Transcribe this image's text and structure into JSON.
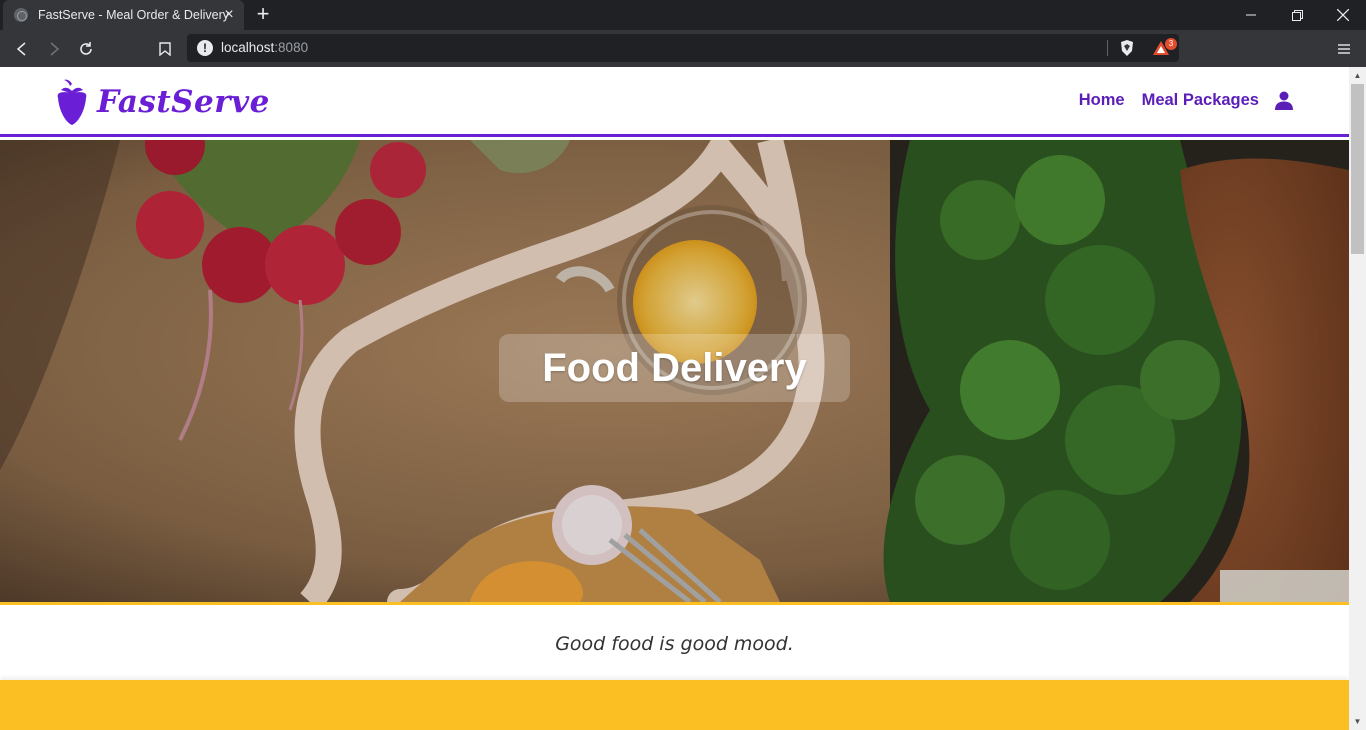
{
  "browser": {
    "tab_title": "FastServe - Meal Order & Delivery",
    "url_host": "localhost",
    "url_port": ":8080",
    "rewards_badge": "3"
  },
  "site": {
    "brand": "FastServe",
    "nav": [
      {
        "label": "Home"
      },
      {
        "label": "Meal Packages"
      }
    ],
    "hero_title": "Food Delivery",
    "tagline": "Good food is good mood."
  },
  "colors": {
    "brand_purple": "#6a1fd6",
    "accent_yellow": "#fbbf24"
  }
}
